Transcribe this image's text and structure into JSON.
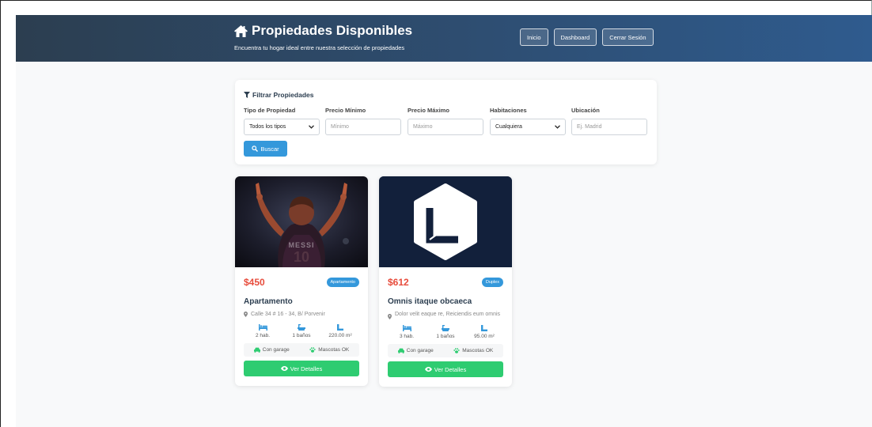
{
  "header": {
    "title": "Propiedades Disponibles",
    "subtitle": "Encuentra tu hogar ideal entre nuestra selección de propiedades",
    "nav": [
      "Inicio",
      "Dashboard",
      "Cerrar Sesión"
    ]
  },
  "filter": {
    "title": "Filtrar Propiedades",
    "fields": [
      {
        "label": "Tipo de Propiedad",
        "value": "Todos los tipos"
      },
      {
        "label": "Precio Mínimo",
        "placeholder": "Mínimo"
      },
      {
        "label": "Precio Máximo",
        "placeholder": "Máximo"
      },
      {
        "label": "Habitaciones",
        "value": "Cualquiera"
      },
      {
        "label": "Ubicación",
        "placeholder": "Ej. Madrid"
      }
    ],
    "search_label": "Buscar"
  },
  "cards": [
    {
      "price": "$450",
      "type": "Apartamento",
      "title": "Apartamento",
      "address": "Calle 34 # 16 - 34, B/ Porvenir",
      "rooms": "2 hab.",
      "baths": "1 baños",
      "area": "220.00 m²",
      "garage": "Con garage",
      "pets": "Mascotas OK",
      "details_label": "Ver Detalles",
      "image_overlay_text": "MESSI"
    },
    {
      "price": "$612",
      "type": "Duplex",
      "title": "Omnis itaque obcaeca",
      "address": "Dolor velit eaque re, Reiciendis eum omnis",
      "rooms": "3 hab.",
      "baths": "1 baños",
      "area": "95.00 m²",
      "garage": "Con garage",
      "pets": "Mascotas OK",
      "details_label": "Ver Detalles"
    }
  ],
  "colors": {
    "header_start": "#2c3e50",
    "header_end": "#2f5b8e",
    "accent": "#3498db",
    "price": "#e74c3c",
    "success": "#2ecc71"
  }
}
